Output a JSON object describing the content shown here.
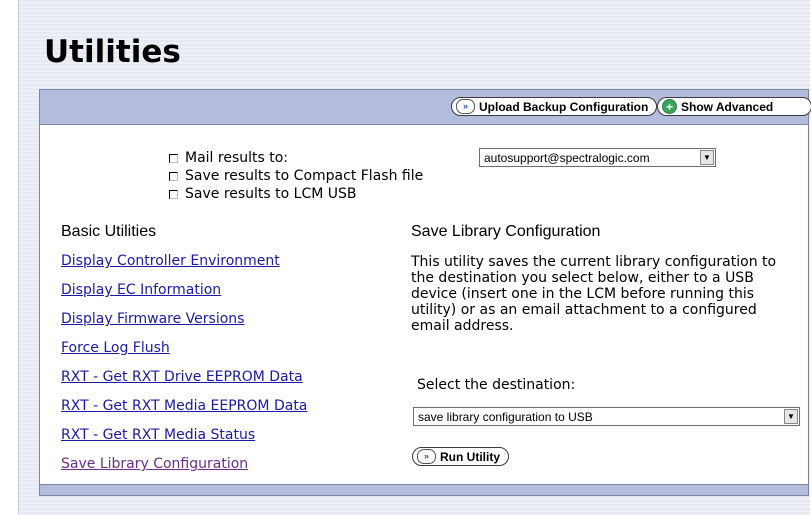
{
  "page": {
    "title": "Utilities"
  },
  "toolbar": {
    "upload_label": "Upload Backup Configuration",
    "advanced_label": "Show Advanced"
  },
  "options": {
    "mail_label": "Mail results to:",
    "mail_value": "autosupport@spectralogic.com",
    "cf_label": "Save results to Compact Flash file",
    "usb_label": "Save results to LCM USB"
  },
  "basic": {
    "heading": "Basic Utilities",
    "links": [
      "Display Controller Environment",
      "Display EC Information",
      "Display Firmware Versions",
      "Force Log Flush",
      "RXT - Get RXT Drive EEPROM Data",
      "RXT - Get RXT Media EEPROM Data",
      "RXT - Get RXT Media Status",
      "Save Library Configuration"
    ]
  },
  "detail": {
    "heading": "Save Library Configuration",
    "description": "This utility saves the current library configuration to the destination you select below, either to a USB device (insert one in the LCM before running this utility) or as an email attachment to a configured email address.",
    "select_label": "Select the destination:",
    "destination_value": "save library configuration to USB",
    "run_label": "Run Utility"
  },
  "icons": {
    "forward": "double-chevron-right-icon",
    "advanced": "plus-circle-icon",
    "dropdown": "dropdown-arrow-icon"
  },
  "colors": {
    "toolbar_bg": "#b3bcdd",
    "link": "#1a1aa6",
    "link_visited": "#6b2d8c",
    "advanced_icon": "#3aa55b"
  }
}
